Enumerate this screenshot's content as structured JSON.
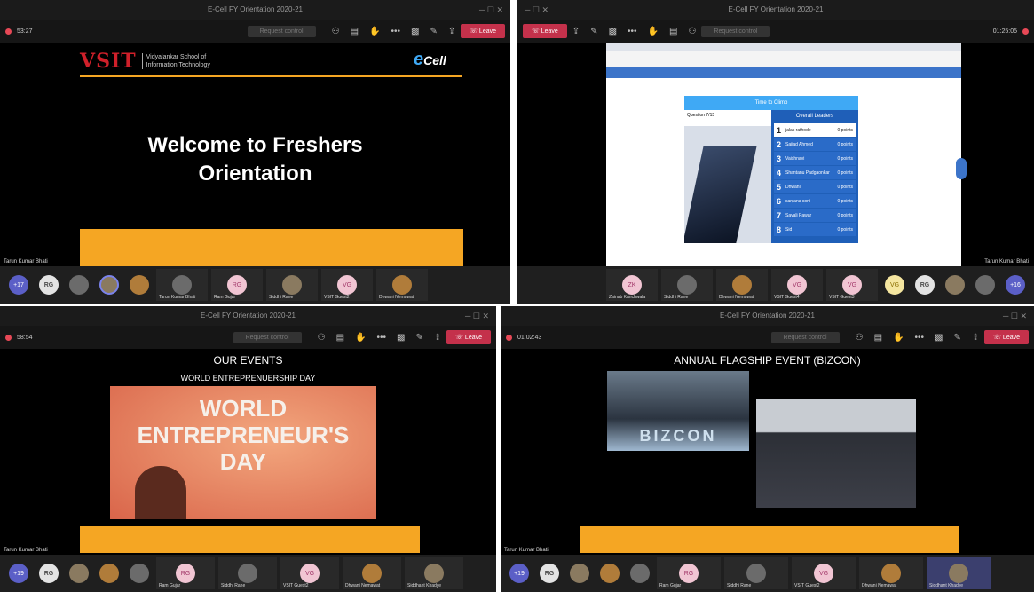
{
  "q1": {
    "window_title": "E-Cell FY Orientation 2020-21",
    "timer": "53:27",
    "request_control": "Request control",
    "leave": "Leave",
    "logo_text": "VSIT",
    "school_line1": "Vidyalankar School of",
    "school_line2": "Information Technology",
    "ecell": "Cell",
    "heading_line1": "Welcome to Freshers",
    "heading_line2": "Orientation",
    "presenter": "Tarun Kumar Bhati",
    "tiles": [
      {
        "name": "Tarun Kumar Bhati"
      },
      {
        "name": "Ram Gujar",
        "initials": "RG"
      },
      {
        "name": "Siddhi Rane"
      },
      {
        "name": "VSIT Guest2",
        "initials": "VG"
      },
      {
        "name": "Dhwani Nemawat"
      }
    ],
    "more": "+17",
    "rg": "RG"
  },
  "q2": {
    "window_title": "E-Cell FY Orientation 2020-21",
    "timer": "01:25:05",
    "leave": "Leave",
    "request_control": "Request control",
    "quiz_title": "Time to Climb",
    "leaders_title": "Overall Leaders",
    "question": "Question 7/15",
    "leaders": [
      {
        "name": "jalak rathode",
        "pts": "0 points"
      },
      {
        "name": "Sajjad Ahmed",
        "pts": "0 points"
      },
      {
        "name": "Vaishnavi",
        "pts": "0 points"
      },
      {
        "name": "Shantanu Padgaonkar",
        "pts": "0 points"
      },
      {
        "name": "Dhwani",
        "pts": "0 points"
      },
      {
        "name": "sanjana soni",
        "pts": "0 points"
      },
      {
        "name": "Sayali Pawar",
        "pts": "0 points"
      },
      {
        "name": "Sid",
        "pts": "0 points"
      }
    ],
    "presenter": "Tarun Kumar Bhati",
    "more": "+16",
    "tiles": [
      {
        "name": "Zainab Kanchwala",
        "initials": "ZK"
      },
      {
        "name": "Siddhi Rane"
      },
      {
        "name": "Dhwani Nemawat"
      },
      {
        "name": "VSIT Guest4",
        "initials": "VG"
      },
      {
        "name": "VSIT Guest3",
        "initials": "VG"
      }
    ],
    "rg": "RG",
    "vg": "VG"
  },
  "q3": {
    "window_title": "E-Cell FY Orientation 2020-21",
    "timer": "58:54",
    "request_control": "Request control",
    "leave": "Leave",
    "heading": "OUR EVENTS",
    "subheading": "WORLD ENTREPRENUERSHIP DAY",
    "poster_line1": "WORLD",
    "poster_line2": "ENTREPRENEUR'S",
    "poster_line3": "DAY",
    "presenter": "Tarun Kumar Bhati",
    "more": "+19",
    "rg": "RG",
    "tiles": [
      {
        "name": "Ram Gujar",
        "initials": "RG"
      },
      {
        "name": "Siddhi Rane"
      },
      {
        "name": "VSIT Guest2",
        "initials": "VG"
      },
      {
        "name": "Dhwani Nemawat"
      },
      {
        "name": "Siddhant Khadye"
      }
    ]
  },
  "q4": {
    "window_title": "E-Cell FY Orientation 2020-21",
    "timer": "01:02:43",
    "request_control": "Request control",
    "leave": "Leave",
    "heading": "ANNUAL FLAGSHIP EVENT (BIZCON)",
    "banner": "BIZCON",
    "presenter": "Tarun Kumar Bhati",
    "more": "+19",
    "rg": "RG",
    "tiles": [
      {
        "name": "Ram Gujar",
        "initials": "RG"
      },
      {
        "name": "Siddhi Rane"
      },
      {
        "name": "VSIT Guest2",
        "initials": "VG"
      },
      {
        "name": "Dhwani Nemawat"
      },
      {
        "name": "Siddhant Khadye"
      }
    ]
  }
}
